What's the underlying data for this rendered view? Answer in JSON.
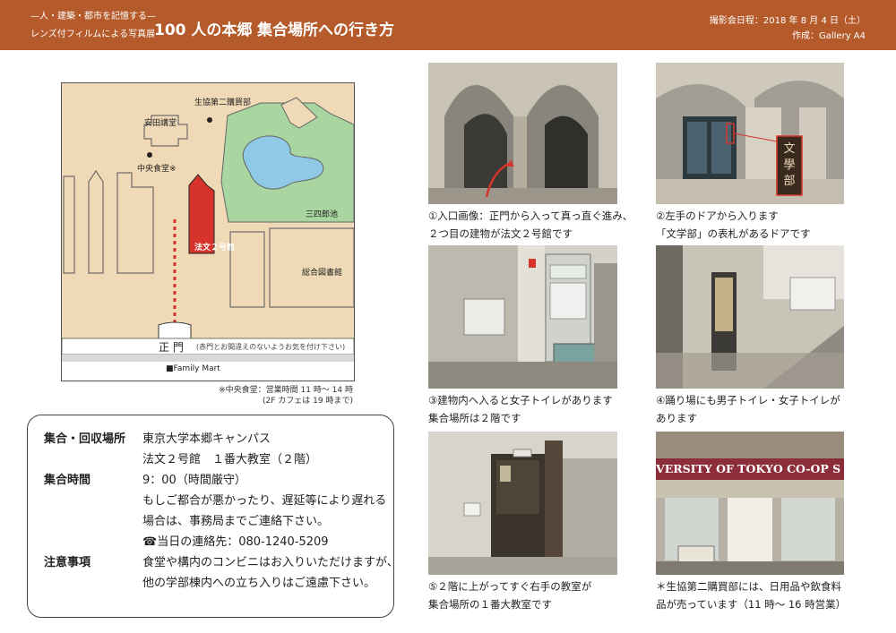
{
  "header": {
    "tagline": "—人・建築・都市を記憶する—",
    "exhibition": "レンズ付フィルムによる写真展",
    "project": "100 人の本郷",
    "title": "集合場所への行き方",
    "date": "撮影会日程：2018 年 8 月 4 日（土）",
    "author": "作成：Gallery A4"
  },
  "map": {
    "coop": "生協第二購買部",
    "yasuda": "安田講堂",
    "cafeteria": "中央食堂※",
    "pond": "三四郎池",
    "building": "法文２号館",
    "library": "総合図書館",
    "main_gate": "正 門",
    "gate_note": "(赤門とお間違えのないようお気を付け下さい)",
    "family_mart": "■Family Mart",
    "footnote1": "※中央食堂：営業時間 11 時〜 14 時",
    "footnote2": "(2F カフェは 19 時まで)",
    "colors": {
      "building": "#d6342a",
      "pond": "#8fc9e6",
      "green": "#a8d5a0",
      "land": "#efd9b6"
    }
  },
  "info": {
    "place_label": "集合・回収場所",
    "place1": "東京大学本郷キャンパス",
    "place2": "法文２号館　１番大教室（２階）",
    "time_label": "集合時間",
    "time1": "9：00（時間厳守）",
    "time2": "もしご都合が悪かったり、遅延等により遅れる",
    "time3": "場合は、事務局までご連絡下さい。",
    "phone_icon": "telephone-icon",
    "phone": "当日の連絡先：080-1240-5209",
    "caution_label": "注意事項",
    "caution1": "食堂や構内のコンビニはお入りいただけますが、",
    "caution2": "他の学部棟内への立ち入りはご遠慮下さい。"
  },
  "photos": [
    {
      "line1": "①入口画像：正門から入って真っ直ぐ進み、",
      "line2": "２つ目の建物が法文２号館です"
    },
    {
      "line1": "②左手のドアから入ります",
      "line2": "「文学部」の表札があるドアです",
      "sign": "文學部"
    },
    {
      "line1": "③建物内へ入ると女子トイレがあります",
      "line2": "集合場所は２階です"
    },
    {
      "line1": "④踊り場にも男子トイレ・女子トイレが",
      "line2": "あります"
    },
    {
      "line1": "⑤２階に上がってすぐ右手の教室が",
      "line2": "集合場所の１番大教室です"
    },
    {
      "line1": "＊生協第二購買部には、日用品や飲食料",
      "line2": "品が売っています（11 時〜 16 時営業）",
      "banner": "VERSITY OF TOKYO CO-OP S"
    }
  ]
}
